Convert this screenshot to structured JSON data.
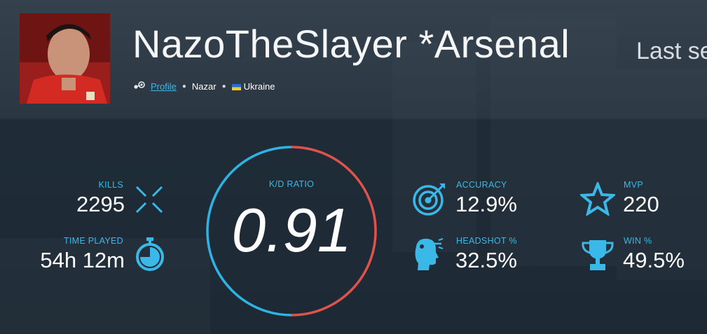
{
  "profile": {
    "name": "NazoTheSlayer *Arsenal",
    "last_seen": "Last se",
    "profile_link": "Profile",
    "real_name": "Nazar",
    "country": "Ukraine"
  },
  "stats": {
    "kills": {
      "label": "KILLS",
      "value": "2295"
    },
    "time_played": {
      "label": "TIME PLAYED",
      "value": "54h 12m"
    },
    "kd": {
      "label": "K/D RATIO",
      "value": "0.91"
    },
    "accuracy": {
      "label": "ACCURACY",
      "value": "12.9%"
    },
    "headshot": {
      "label": "HEADSHOT %",
      "value": "32.5%"
    },
    "mvp": {
      "label": "MVP",
      "value": "220"
    },
    "win": {
      "label": "WIN %",
      "value": "49.5%"
    }
  },
  "colors": {
    "accent": "#3ab8e8",
    "ring_red": "#e0534a",
    "ring_blue": "#2fb3e4"
  },
  "icons": [
    "steam-icon",
    "kills-cross-icon",
    "stopwatch-icon",
    "target-icon",
    "headshot-icon",
    "star-icon",
    "trophy-icon"
  ]
}
